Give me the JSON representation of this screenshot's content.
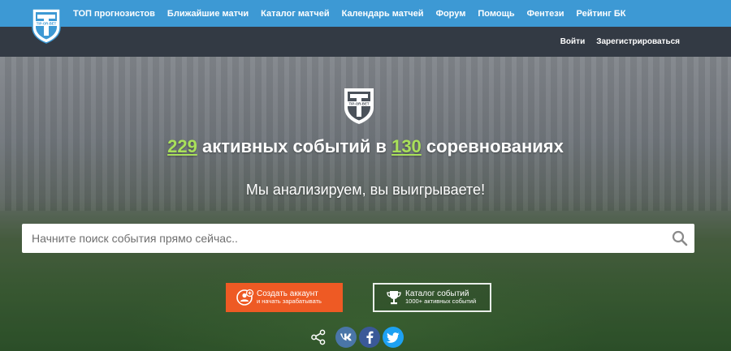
{
  "nav": {
    "items": [
      {
        "label": "ТОП прогнозистов"
      },
      {
        "label": "Ближайшие матчи"
      },
      {
        "label": "Каталог матчей"
      },
      {
        "label": "Календарь матчей"
      },
      {
        "label": "Форум"
      },
      {
        "label": "Помощь"
      },
      {
        "label": "Фентези"
      },
      {
        "label": "Рейтинг БК"
      }
    ]
  },
  "auth": {
    "login": "Войти",
    "register": "Зарегистрироваться"
  },
  "logo": {
    "text": "TIP-OR-BET",
    "icon": "shield-logo-icon"
  },
  "hero": {
    "events_count": "229",
    "events_text": " активных событий в ",
    "competitions_count": "130",
    "competitions_text": " соревнованиях",
    "tagline": "Мы анализируем, вы выигрываете!"
  },
  "search": {
    "placeholder": "Начните поиск события прямо сейчас..",
    "value": ""
  },
  "buttons": {
    "create": {
      "line1": "Создать аккаунт",
      "line2": "и начать зарабатывать",
      "icon": "add-user-icon"
    },
    "catalog": {
      "line1": "Каталог событий",
      "line2": "1000+ активных событий",
      "icon": "trophy-icon"
    }
  },
  "social": {
    "share_icon": "share-icon",
    "vk_icon": "vk-icon",
    "facebook_icon": "facebook-icon",
    "twitter_icon": "twitter-icon"
  },
  "colors": {
    "topbar": "#3d99d4",
    "subbar": "#333a44",
    "accent_green": "#a9e05a",
    "create_button": "#ee5a24"
  }
}
